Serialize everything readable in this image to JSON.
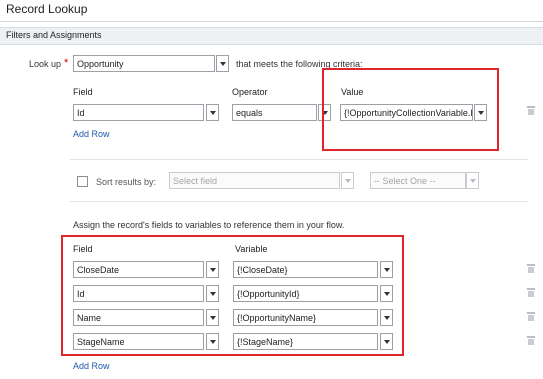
{
  "header": {
    "title": "Record Lookup"
  },
  "section": {
    "title": "Filters and Assignments"
  },
  "lookup": {
    "label": "Look up",
    "required_mark": "*",
    "object_value": "Opportunity",
    "criteria_text": "that meets the following criteria:"
  },
  "filters": {
    "headers": {
      "field": "Field",
      "operator": "Operator",
      "value": "Value"
    },
    "rows": [
      {
        "field": "Id",
        "operator": "equals",
        "value": "{!OpportunityCollectionVariable.Id}"
      }
    ],
    "add_row": "Add Row"
  },
  "sort": {
    "label": "Sort results by:",
    "field_placeholder": "Select field",
    "order_placeholder": "-- Select One --"
  },
  "assign": {
    "instruction": "Assign the record's fields to variables to reference them in your flow.",
    "headers": {
      "field": "Field",
      "variable": "Variable"
    },
    "rows": [
      {
        "field": "CloseDate",
        "variable": "{!CloseDate}"
      },
      {
        "field": "Id",
        "variable": "{!OpportunityId}"
      },
      {
        "field": "Name",
        "variable": "{!OpportunityName}"
      },
      {
        "field": "StageName",
        "variable": "{!StageName}"
      }
    ],
    "add_row": "Add Row"
  },
  "colors": {
    "highlight": "#e0262a",
    "link": "#1d5aa8",
    "required": "#cc0000"
  },
  "icons": {
    "dropdown": "chevron-down-icon",
    "delete": "trash-icon"
  }
}
